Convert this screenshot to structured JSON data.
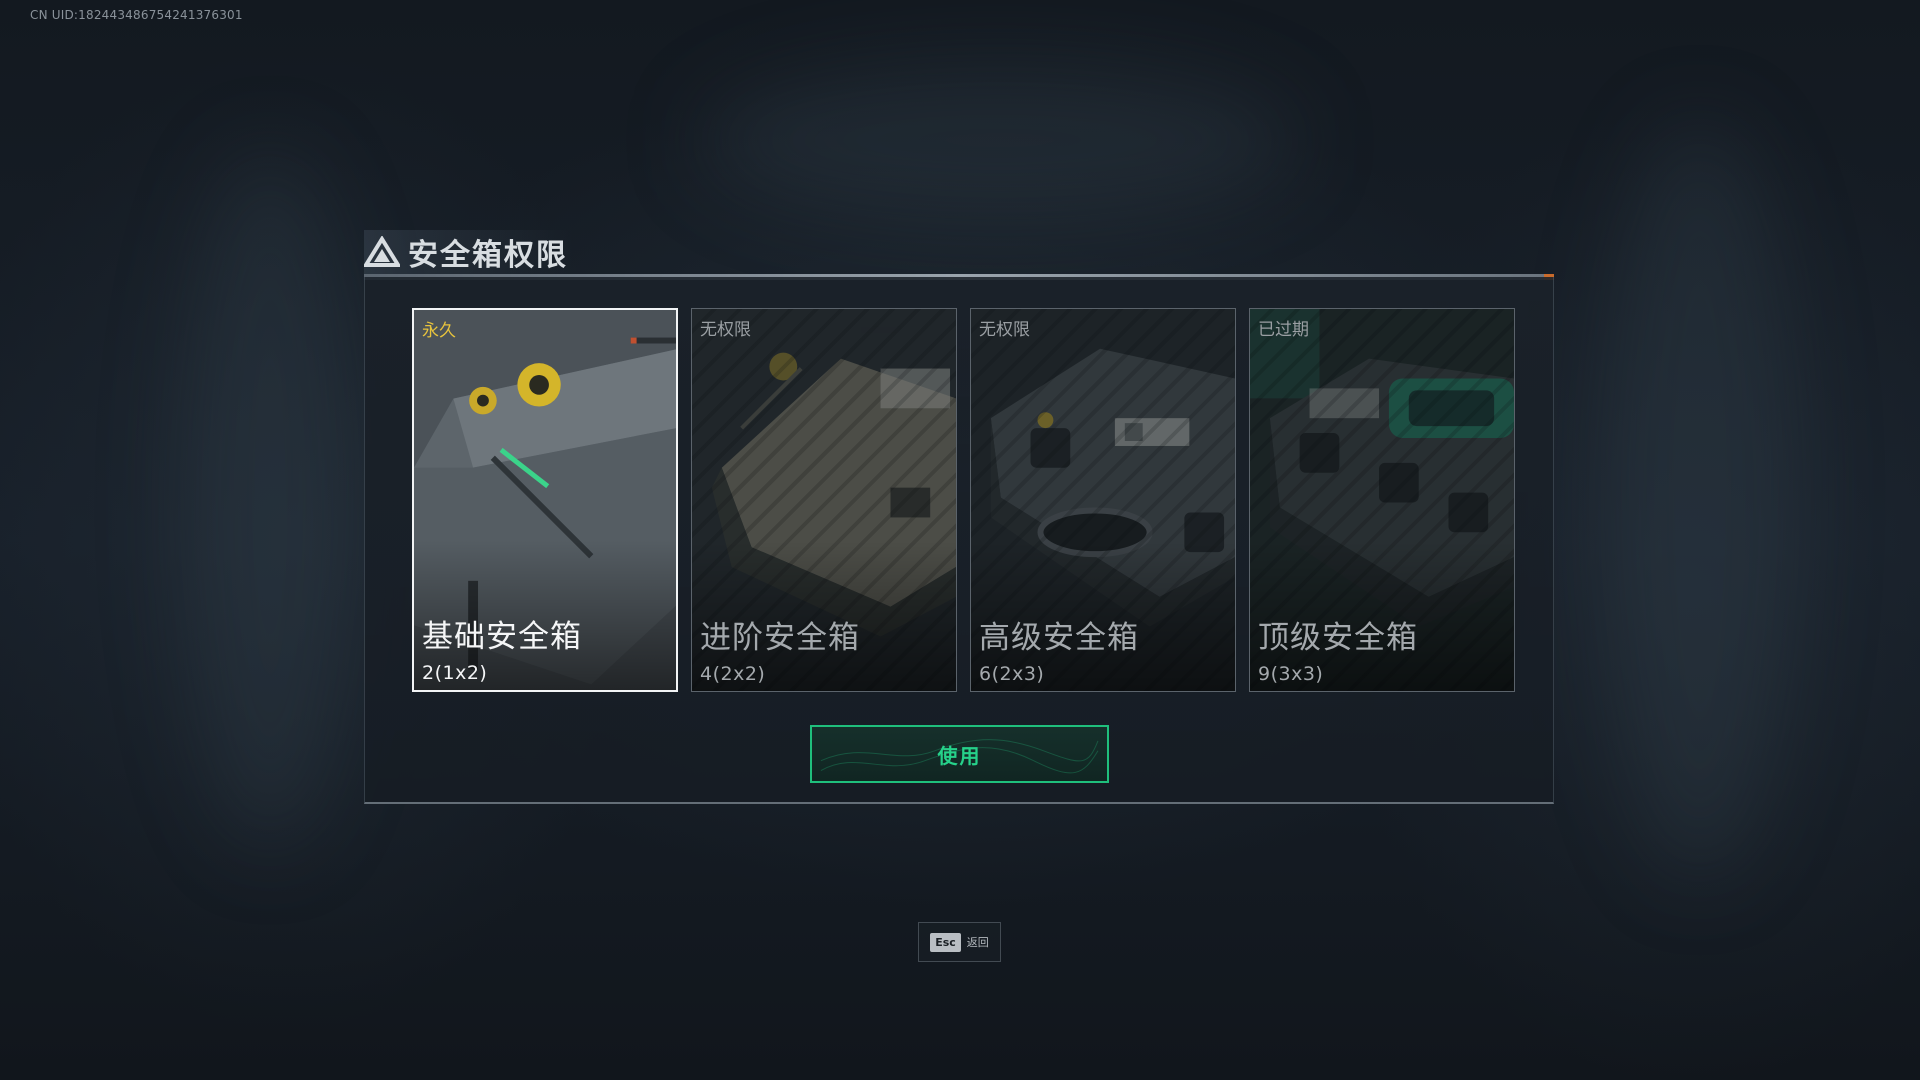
{
  "uid": "CN UID:182443486754241376301",
  "panel": {
    "title": "安全箱权限"
  },
  "cards": [
    {
      "status": "永久",
      "name": "基础安全箱",
      "capacity": "2(1x2)",
      "selected": true
    },
    {
      "status": "无权限",
      "name": "进阶安全箱",
      "capacity": "4(2x2)",
      "selected": false
    },
    {
      "status": "无权限",
      "name": "高级安全箱",
      "capacity": "6(2x3)",
      "selected": false
    },
    {
      "status": "已过期",
      "name": "顶级安全箱",
      "capacity": "9(3x3)",
      "selected": false
    }
  ],
  "actions": {
    "use_label": "使用",
    "esc_key": "Esc",
    "esc_label": "返回"
  },
  "colors": {
    "accent_green": "#26d18a",
    "permanent_yellow": "#e7c33d",
    "selected_border": "#f2f4f5"
  }
}
